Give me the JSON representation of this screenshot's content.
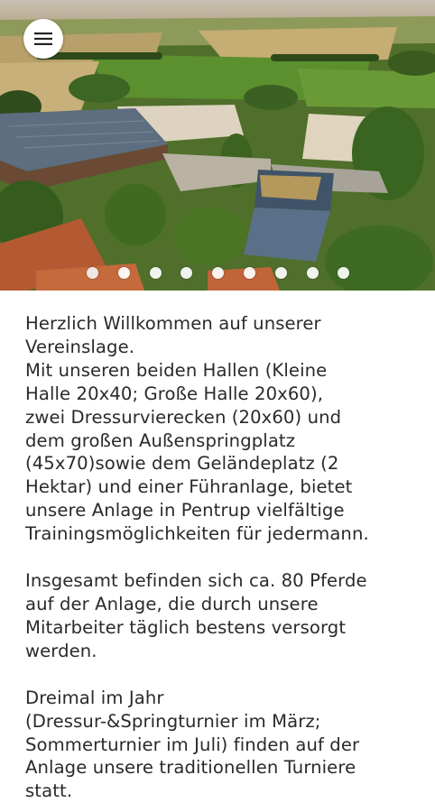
{
  "menu": {
    "icon": "hamburger-menu-icon"
  },
  "slideshow": {
    "slide_count": 9,
    "active_index": 0
  },
  "content": {
    "paragraph_1_lines": [
      "Herzlich Willkommen auf unserer",
      "Vereinslage.",
      "Mit unseren beiden Hallen (Kleine",
      "Halle 20x40; Große Halle 20x60),",
      "zwei Dressurvierecken (20x60) und",
      "dem großen Außenspringplatz",
      "(45x70)sowie dem Geländeplatz (2",
      "Hektar) und einer Führanlage, bietet",
      "unsere Anlage in Pentrup vielfältige",
      "Trainingsmöglichkeiten für jedermann."
    ],
    "paragraph_2_lines": [
      "Insgesamt befinden sich ca. 80 Pferde",
      "auf der Anlage, die durch unsere",
      "Mitarbeiter täglich bestens versorgt",
      "werden."
    ],
    "paragraph_3_lines": [
      "Dreimal im Jahr",
      "(Dressur-&Springturnier im März;",
      "Sommerturnier im Juli) finden auf der",
      "Anlage unsere traditionellen Turniere",
      "statt."
    ]
  }
}
